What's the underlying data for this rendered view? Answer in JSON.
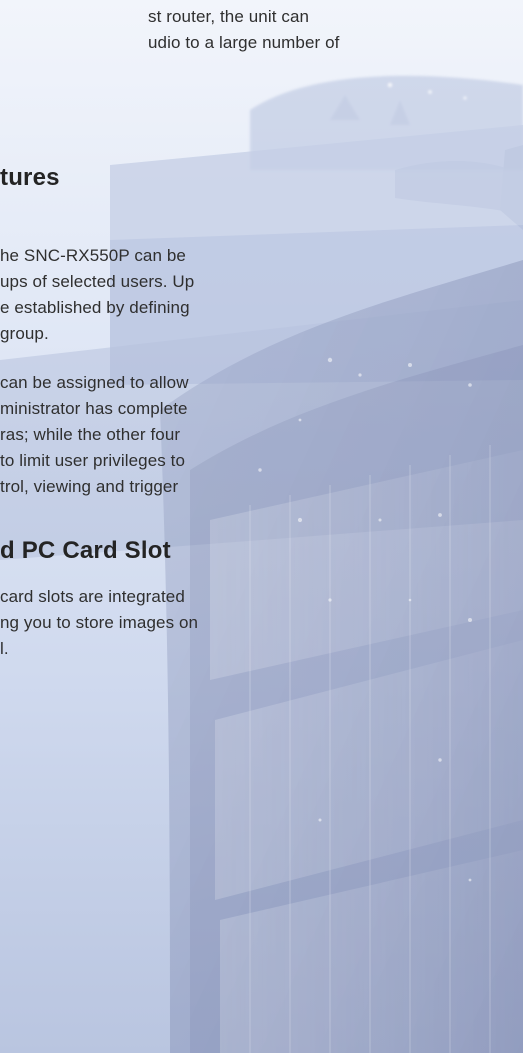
{
  "page": {
    "blocks": [
      {
        "type": "paragraph",
        "lines": [
          "st router, the unit can",
          "udio to a large number of"
        ]
      },
      {
        "type": "heading",
        "text": "tures"
      },
      {
        "type": "paragraph",
        "lines": [
          "he SNC-RX550P can be",
          "ups of selected users. Up",
          "e established by defining",
          "group."
        ]
      },
      {
        "type": "paragraph",
        "lines": [
          "can be assigned to allow",
          "ministrator has complete",
          "ras; while the other four",
          "to limit user privileges to",
          "trol, viewing and trigger"
        ]
      },
      {
        "type": "heading",
        "text": "d PC Card Slot"
      },
      {
        "type": "paragraph",
        "lines": [
          "card slots are integrated",
          "ng you to store images on",
          "l."
        ]
      }
    ]
  }
}
